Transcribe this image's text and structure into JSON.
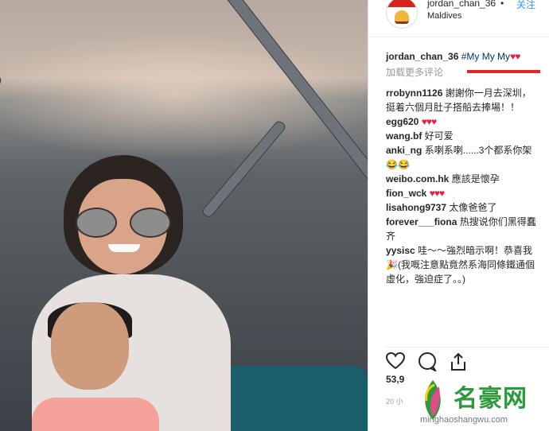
{
  "header": {
    "username": "jordan_chan_36",
    "separator": "•",
    "follow_label": "关注",
    "location": "Maldives"
  },
  "caption": {
    "username": "jordan_chan_36",
    "text": "#My My My",
    "hearts": "♥♥"
  },
  "load_more": "加载更多评论",
  "comments": [
    {
      "user": "rrobynn1126",
      "text": "謝謝你一月去深圳，",
      "text2": "挺着六個月肚子搭船去捧場！！"
    },
    {
      "user": "egg620",
      "text": "",
      "hearts": "♥♥♥"
    },
    {
      "user": "wang.bf",
      "text": "好可爱"
    },
    {
      "user": "anki_ng",
      "text": "系喇系喇......3个都系你架",
      "text2": "😂😂"
    },
    {
      "user": "weibo.com.hk",
      "text": "應該是懷孕"
    },
    {
      "user": "fion_wck",
      "text": "",
      "hearts": "♥♥♥"
    },
    {
      "user": "lisahong9737",
      "text": "太像爸爸了"
    },
    {
      "user": "forever___fiona",
      "text": "热搜说你们黑得蠢",
      "text2": "齐"
    },
    {
      "user": "yysisc",
      "text": "哇～～強烈暗示啊！恭喜我",
      "text2": "🎉(我嘅注意點竟然系海同條鐵通個",
      "text3": "虛化，強迫症了。。)"
    }
  ],
  "likes": "53,9",
  "time": "20 小",
  "watermark": {
    "title": "名豪网",
    "url": "minghaoshangwu.com"
  },
  "colors": {
    "link": "#3897f0",
    "heart": "#ed1c3f",
    "accent_line": "#e8242b",
    "watermark_green": "#2b9a3a"
  }
}
